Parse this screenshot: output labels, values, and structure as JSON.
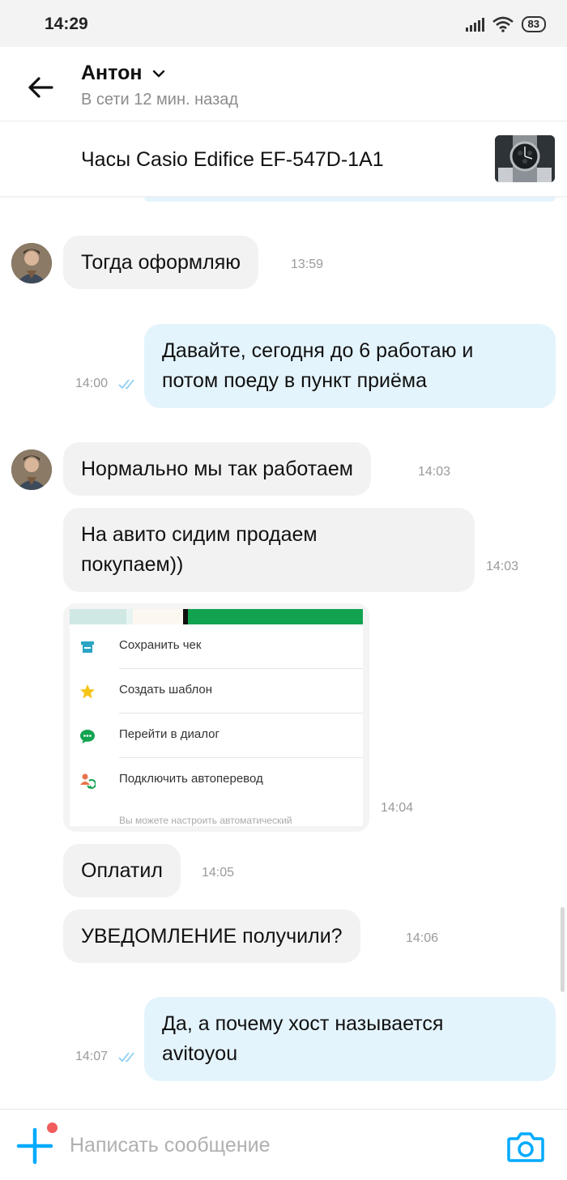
{
  "status_bar": {
    "time": "14:29",
    "battery": "83"
  },
  "header": {
    "contact_name": "Антон",
    "contact_status": "В сети 12 мин. назад"
  },
  "item": {
    "title": "Часы Casio Edifice EF-547D-1A1"
  },
  "messages": [
    {
      "direction": "in",
      "text": "Тогда оформляю",
      "time": "13:59"
    },
    {
      "direction": "out",
      "lines": [
        "Давайте, сегодня до 6 работаю и",
        "потом поеду в пункт приёма"
      ],
      "time": "14:00",
      "read": true
    },
    {
      "direction": "in",
      "text": "Нормально мы так работаем",
      "time": "14:03"
    },
    {
      "direction": "in",
      "lines": [
        "На авито сидим продаем",
        "покупаем))"
      ],
      "time": "14:03"
    },
    {
      "direction": "in",
      "type": "image",
      "time": "14:04",
      "image_content": {
        "menu_items": [
          "Сохранить чек",
          "Создать шаблон",
          "Перейти в диалог",
          "Подключить автоперевод"
        ],
        "footer_text": "Вы можете настроить автоматический"
      }
    },
    {
      "direction": "in",
      "text": "Оплатил",
      "time": "14:05"
    },
    {
      "direction": "in",
      "text": "УВЕДОМЛЕНИЕ получили?",
      "time": "14:06"
    },
    {
      "direction": "out",
      "lines": [
        "Да, а почему хост называется",
        "avitoyou"
      ],
      "time": "14:07",
      "read": true
    }
  ],
  "composer": {
    "placeholder": "Написать сообщение"
  },
  "colors": {
    "accent": "#00aaff",
    "incoming_bubble": "#f2f2f2",
    "outgoing_bubble": "#e4f4fd",
    "notification_dot": "#f25c5c"
  }
}
